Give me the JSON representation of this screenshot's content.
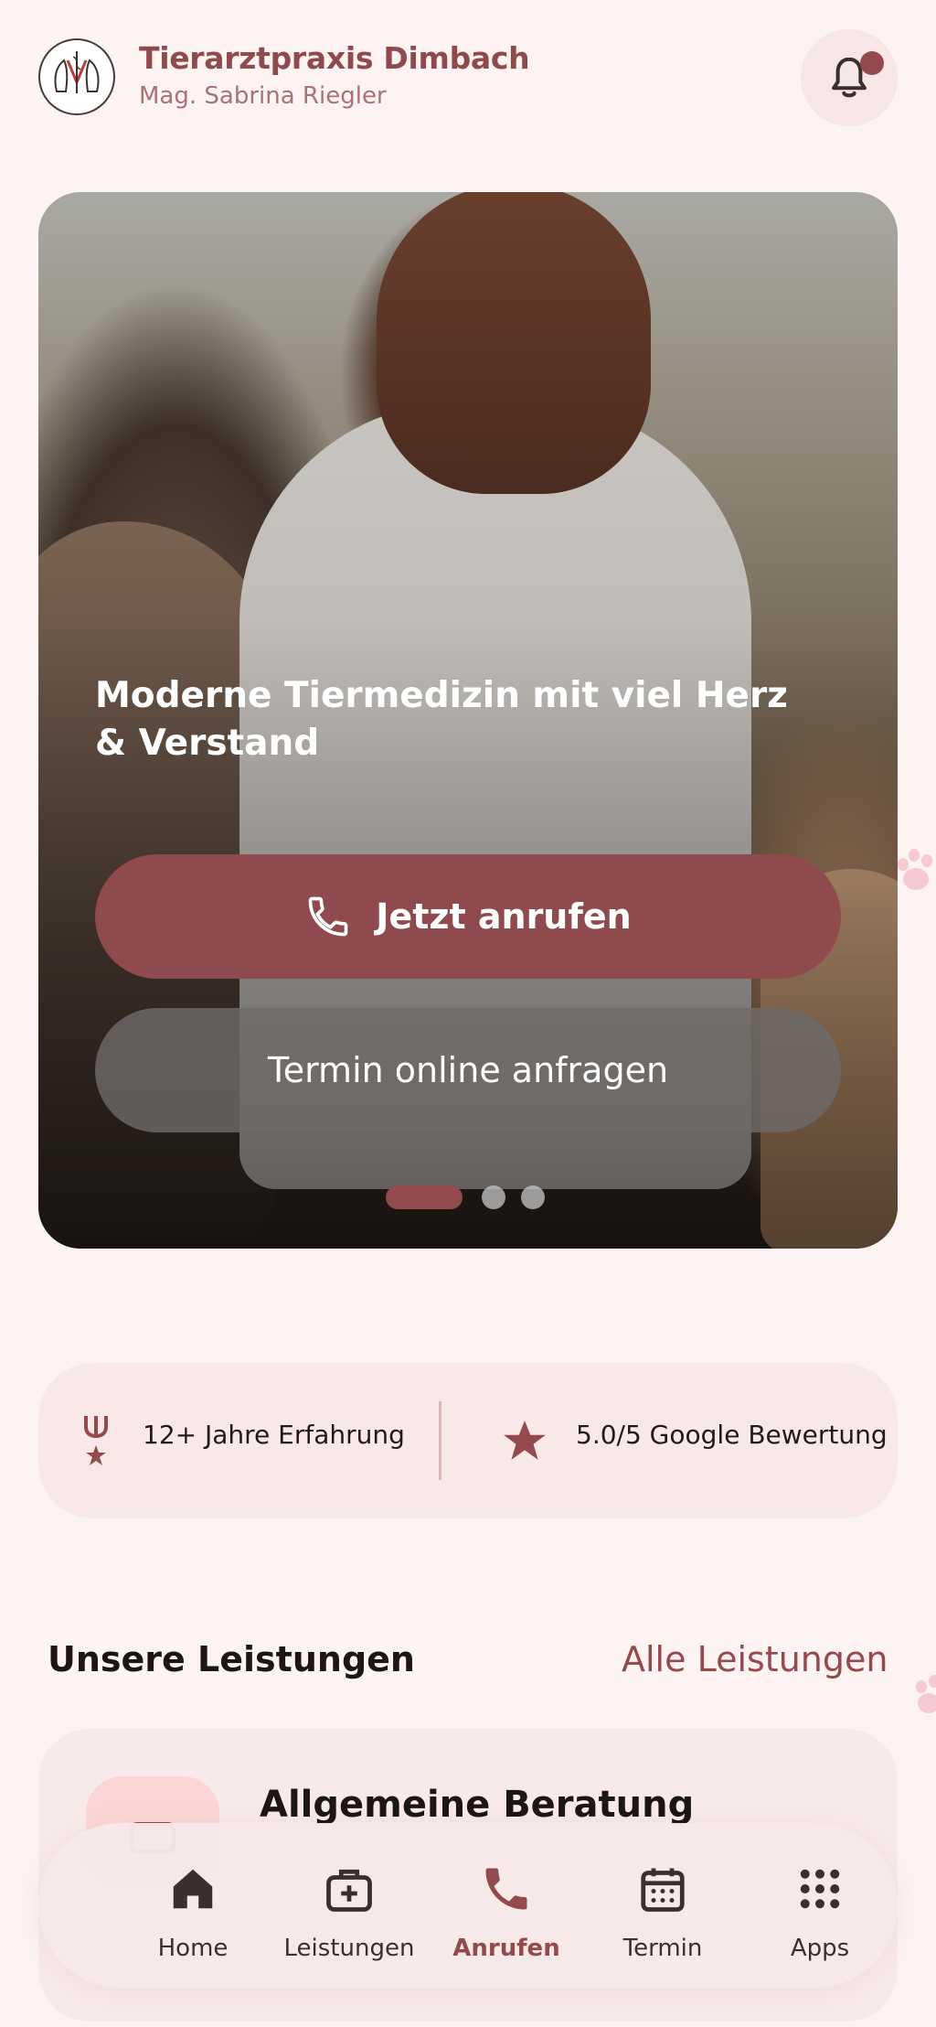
{
  "header": {
    "title": "Tierarztpraxis Dimbach",
    "subtitle": "Mag. Sabrina Riegler",
    "logo_icon": "clinic-logo-icon",
    "notification_icon": "bell-icon"
  },
  "hero": {
    "tagline": "Moderne Tiermedizin mit viel Herz & Verstand",
    "call_button_label": "Jetzt anrufen",
    "online_button_label": "Termin online anfragen",
    "carousel": {
      "slides": 3,
      "active_index": 0
    }
  },
  "stats": {
    "experience": "12+ Jahre Erfahrung",
    "rating": "5.0/5 Google Bewertung"
  },
  "services": {
    "section_title": "Unsere Leistungen",
    "all_link": "Alle Leistungen",
    "items": [
      {
        "title": "Allgemeine Beratung"
      }
    ]
  },
  "nav": {
    "items": [
      {
        "label": "Home",
        "icon": "home-icon"
      },
      {
        "label": "Leistungen",
        "icon": "medical-kit-icon"
      },
      {
        "label": "Anrufen",
        "icon": "phone-icon",
        "active": true
      },
      {
        "label": "Termin",
        "icon": "calendar-icon"
      },
      {
        "label": "Apps",
        "icon": "apps-grid-icon"
      }
    ]
  },
  "colors": {
    "brand": "#8e4a4d",
    "background": "#fdf3f2",
    "card": "#f8e9e8"
  }
}
